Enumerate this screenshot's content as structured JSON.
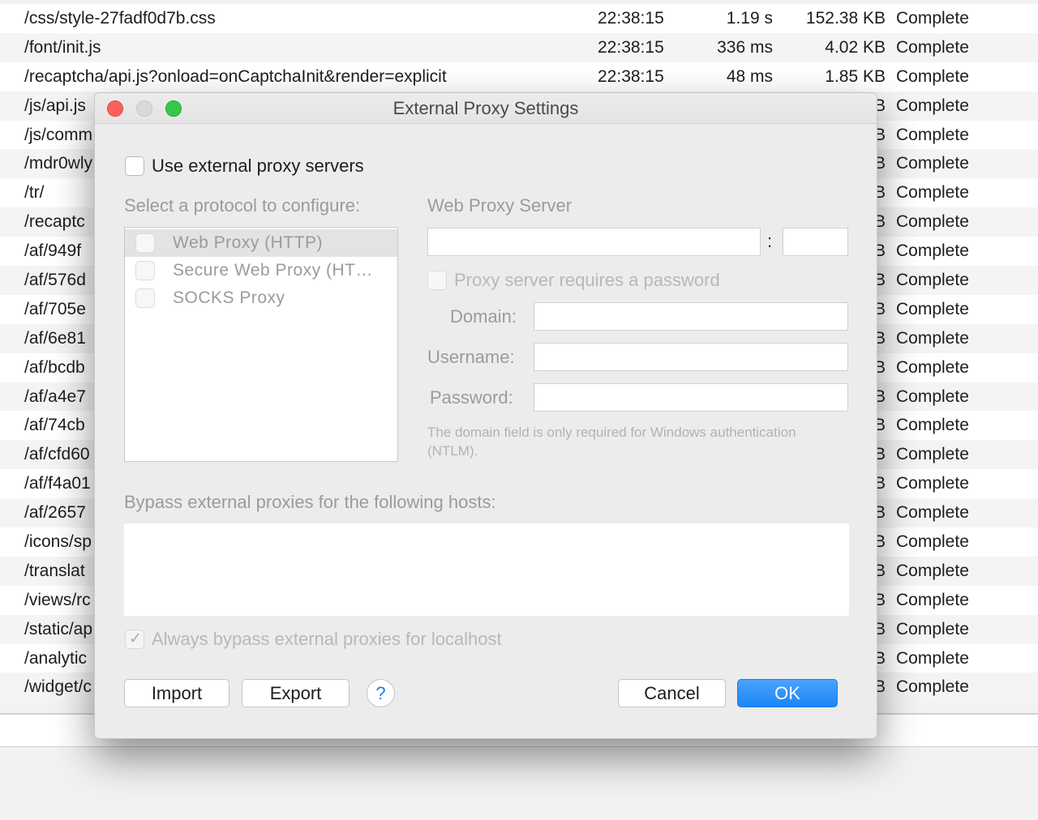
{
  "background": {
    "rows": [
      {
        "path": "/css/style-27fadf0d7b.css",
        "time": "22:38:15",
        "duration": "1.19 s",
        "size": "152.38 KB",
        "status": "Complete"
      },
      {
        "path": "/font/init.js",
        "time": "22:38:15",
        "duration": "336 ms",
        "size": "4.02 KB",
        "status": "Complete"
      },
      {
        "path": "/recaptcha/api.js?onload=onCaptchaInit&render=explicit",
        "time": "22:38:15",
        "duration": "48 ms",
        "size": "1.85 KB",
        "status": "Complete"
      },
      {
        "path": "/js/api.js",
        "status": "Complete"
      },
      {
        "path": "/js/comm",
        "status": "Complete"
      },
      {
        "path": "/mdr0wly",
        "status": "Complete"
      },
      {
        "path": "/tr/",
        "status": "Complete"
      },
      {
        "path": "/recaptc",
        "status": "Complete"
      },
      {
        "path": "/af/949f",
        "status": "Complete"
      },
      {
        "path": "/af/576d",
        "status": "Complete"
      },
      {
        "path": "/af/705e",
        "status": "Complete"
      },
      {
        "path": "/af/6e81",
        "status": "Complete"
      },
      {
        "path": "/af/bcdb",
        "status": "Complete"
      },
      {
        "path": "/af/a4e7",
        "status": "Complete"
      },
      {
        "path": "/af/74cb",
        "status": "Complete"
      },
      {
        "path": "/af/cfd60",
        "status": "Complete"
      },
      {
        "path": "/af/f4a01",
        "status": "Complete"
      },
      {
        "path": "/af/2657",
        "status": "Complete"
      },
      {
        "path": "/icons/sp",
        "status": "Complete"
      },
      {
        "path": "/translat",
        "status": "Complete"
      },
      {
        "path": "/views/rc",
        "status": "Complete"
      },
      {
        "path": "/static/ap",
        "status": "Complete"
      },
      {
        "path": "/analytic",
        "status": "Complete"
      },
      {
        "path": "/widget/c",
        "status": "Complete"
      }
    ],
    "size_fragment": "B"
  },
  "dialog": {
    "title": "External Proxy Settings",
    "use_proxy_label": "Use external proxy servers",
    "protocol_heading": "Select a protocol to configure:",
    "protocols": [
      {
        "label": "Web Proxy (HTTP)",
        "selected": true
      },
      {
        "label": "Secure Web Proxy (HT…",
        "selected": false
      },
      {
        "label": "SOCKS Proxy",
        "selected": false
      }
    ],
    "server_heading": "Web Proxy Server",
    "port_separator": ":",
    "host_value": "",
    "port_value": "",
    "requires_password_label": "Proxy server requires a password",
    "domain_label": "Domain:",
    "username_label": "Username:",
    "password_label": "Password:",
    "domain_value": "",
    "username_value": "",
    "password_value": "",
    "hint": "The domain field is only required for Windows authentication (NTLM).",
    "bypass_heading": "Bypass external proxies for the following hosts:",
    "bypass_value": "",
    "always_bypass_label": "Always bypass external proxies for localhost",
    "check_glyph": "✓",
    "import_label": "Import",
    "export_label": "Export",
    "help_label": "?",
    "cancel_label": "Cancel",
    "ok_label": "OK"
  },
  "colors": {
    "ok_button": "#1b86f5",
    "close_light": "#fc605c",
    "zoom_light": "#34c84a"
  }
}
